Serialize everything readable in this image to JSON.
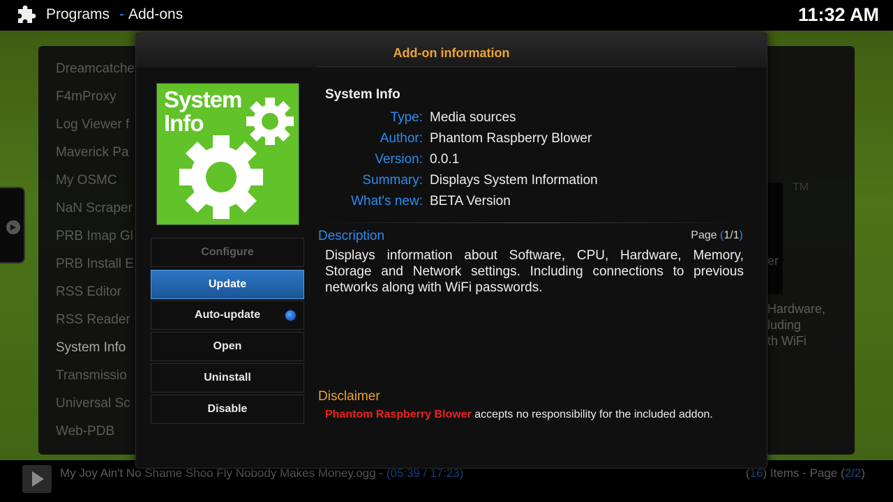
{
  "header": {
    "title": "Programs",
    "separator": "-",
    "subtitle": "Add-ons",
    "clock": "11:32 AM"
  },
  "background": {
    "list_items": [
      "Dreamcatcher",
      "F4mProxy",
      "Log Viewer f",
      "Maverick Pa",
      "My OSMC",
      "NaN Scraper",
      "PRB Imap Gl",
      "PRB Install E",
      "RSS Editor",
      "RSS Reader",
      "System Info",
      "Transmissio",
      "Universal Sc",
      "Web-PDB"
    ],
    "selected_index": 10,
    "right_tm": "TM",
    "right_er": "er",
    "right_desc_lines": [
      "Hardware,",
      "luding",
      "th WiFi"
    ]
  },
  "footer": {
    "now_playing": "My Joy Ain't No Shame Shoo Fly Nobody Makes Money.ogg - ",
    "time_open": "(",
    "time": "05:39 / 17:23",
    "time_close": ")",
    "items_open": "(",
    "items_count": "16",
    "items_text": ") Items - Page (",
    "page": "2/2",
    "page_close": ")"
  },
  "dialog": {
    "title": "Add-on information",
    "icon_text_line1": "System",
    "icon_text_line2": "Info",
    "buttons": {
      "configure": "Configure",
      "update": "Update",
      "auto_update": "Auto-update",
      "open": "Open",
      "uninstall": "Uninstall",
      "disable": "Disable"
    },
    "auto_update_enabled": true,
    "name": "System Info",
    "fields": {
      "type_label": "Type:",
      "type_value": "Media sources",
      "author_label": "Author:",
      "author_value": "Phantom Raspberry Blower",
      "version_label": "Version:",
      "version_value": "0.0.1",
      "summary_label": "Summary:",
      "summary_value": "Displays System Information",
      "whatsnew_label": "What's new:",
      "whatsnew_value": "BETA Version"
    },
    "description_heading": "Description",
    "page_label": "Page ",
    "page_open": "(",
    "page_value": "1/1",
    "page_close": ")",
    "description": "Displays information about Software, CPU, Hardware, Memory, Storage and Network settings. Including connections to previous networks along with WiFi passwords.",
    "disclaimer_heading": "Disclaimer",
    "disclaimer_author": "Phantom Raspberry Blower",
    "disclaimer_text": " accepts no responsibility for the included addon."
  },
  "colors": {
    "accent_blue": "#2c8cf0",
    "title_orange": "#eba433",
    "icon_green": "#61c229",
    "warning_red": "#f0201f"
  }
}
